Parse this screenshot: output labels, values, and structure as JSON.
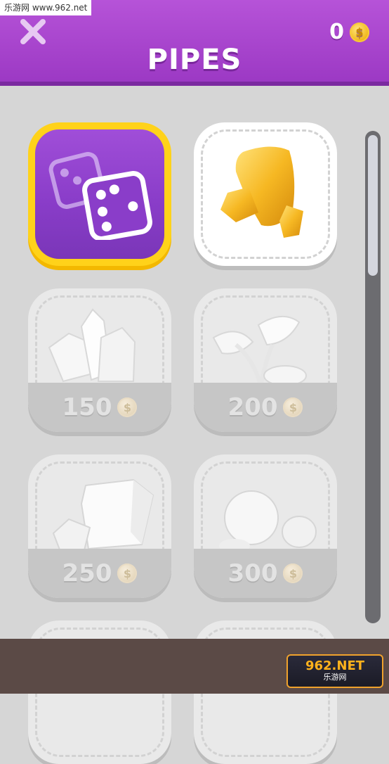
{
  "header": {
    "title": "PIPES",
    "coin_count": "0",
    "coin_symbol": "$"
  },
  "watermark": {
    "top_text": "乐游网 www.962.net",
    "brand_main": "962.NET",
    "brand_sub": "乐游网"
  },
  "colors": {
    "header_purple": "#a845d0",
    "selected_frame": "#ffd21a",
    "gold": "#f0b516"
  },
  "tiles": [
    {
      "name": "random-dice",
      "state": "selected",
      "icon": "dice-icon"
    },
    {
      "name": "gold-nugget",
      "state": "owned",
      "icon": "gold-nugget-icon"
    },
    {
      "name": "crystals",
      "state": "locked",
      "price": "150",
      "icon": "crystal-icon"
    },
    {
      "name": "leaves",
      "state": "locked",
      "price": "200",
      "icon": "leaves-icon"
    },
    {
      "name": "block",
      "state": "locked",
      "price": "250",
      "icon": "block-icon"
    },
    {
      "name": "sphere",
      "state": "locked",
      "price": "300",
      "icon": "sphere-icon"
    }
  ]
}
